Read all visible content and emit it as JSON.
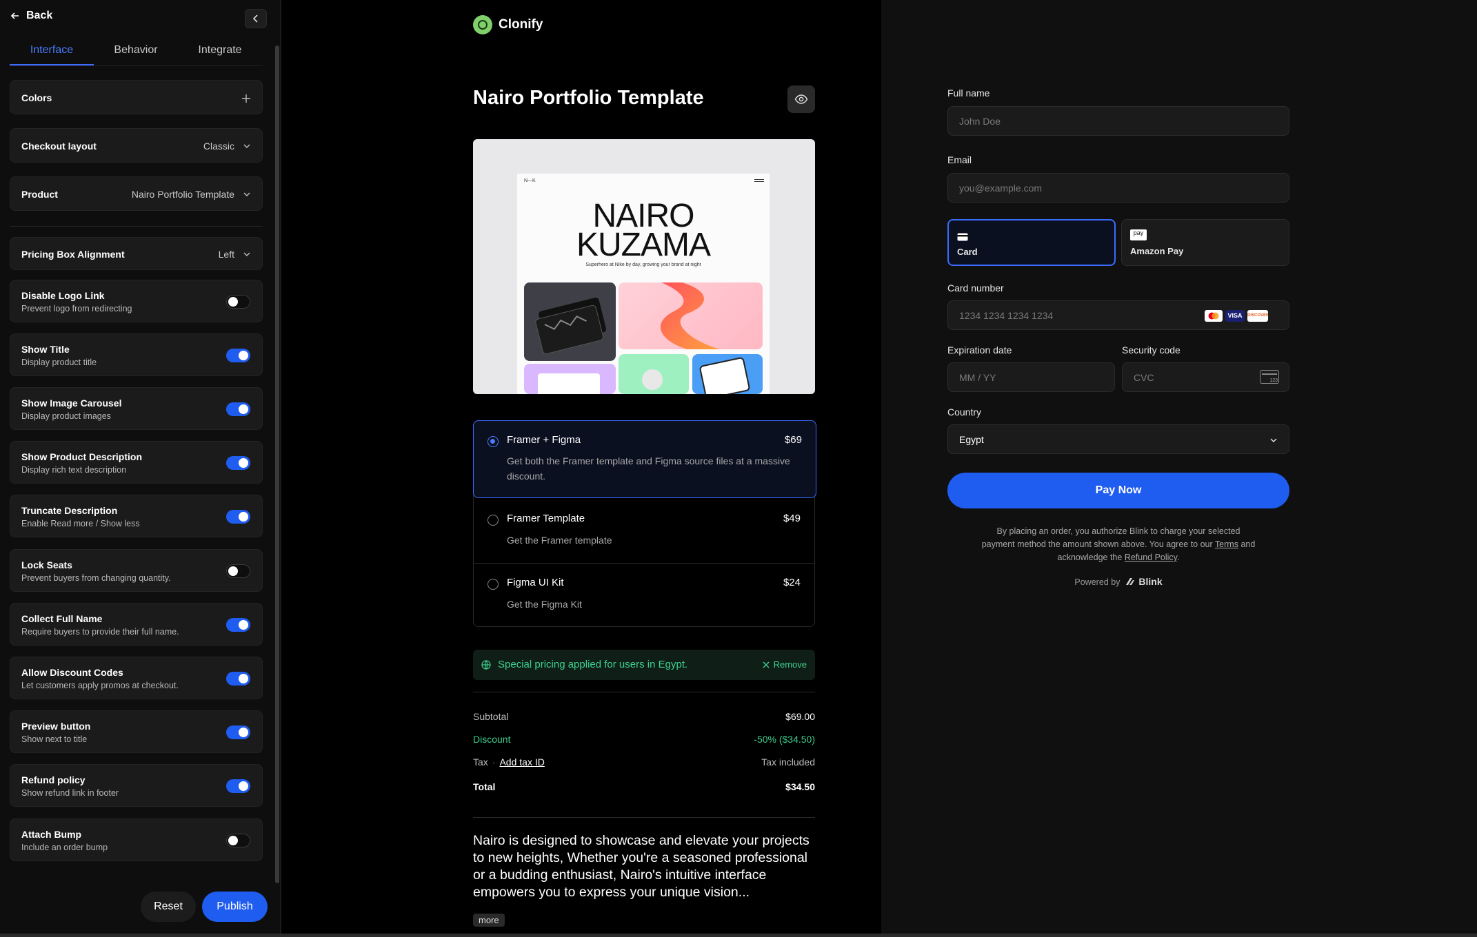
{
  "sidebar": {
    "back_label": "Back",
    "tabs": [
      "Interface",
      "Behavior",
      "Integrate"
    ],
    "colors_label": "Colors",
    "checkout_layout": {
      "label": "Checkout layout",
      "value": "Classic"
    },
    "product": {
      "label": "Product",
      "value": "Nairo Portfolio Template"
    },
    "pricing_alignment": {
      "label": "Pricing Box Alignment",
      "value": "Left"
    },
    "toggles": [
      {
        "title": "Disable Logo Link",
        "desc": "Prevent logo from redirecting",
        "on": false
      },
      {
        "title": "Show Title",
        "desc": "Display product title",
        "on": true
      },
      {
        "title": "Show Image Carousel",
        "desc": "Display product images",
        "on": true
      },
      {
        "title": "Show Product Description",
        "desc": "Display rich text description",
        "on": true
      },
      {
        "title": "Truncate Description",
        "desc": "Enable Read more / Show less",
        "on": true
      },
      {
        "title": "Lock Seats",
        "desc": "Prevent buyers from changing quantity.",
        "on": false
      },
      {
        "title": "Collect Full Name",
        "desc": "Require buyers to provide their full name.",
        "on": true
      },
      {
        "title": "Allow Discount Codes",
        "desc": "Let customers apply promos at checkout.",
        "on": true
      },
      {
        "title": "Preview button",
        "desc": "Show next to title",
        "on": true
      },
      {
        "title": "Refund policy",
        "desc": "Show refund link in footer",
        "on": true
      },
      {
        "title": "Attach Bump",
        "desc": "Include an order bump",
        "on": false
      }
    ],
    "reset_label": "Reset",
    "publish_label": "Publish"
  },
  "checkout": {
    "brand": "Clonify",
    "product_title": "Nairo Portfolio Template",
    "preview_image": {
      "corner_text": "N—K",
      "hero_line1": "NAIRO",
      "hero_line2": "KUZAMA",
      "tagline": "Superhero at Nike by day, growing your brand at night"
    },
    "options": [
      {
        "name": "Framer + Figma",
        "price": "$69",
        "desc": "Get both the Framer template and Figma source files at a massive discount.",
        "selected": true
      },
      {
        "name": "Framer Template",
        "price": "$49",
        "desc": "Get the Framer template",
        "selected": false
      },
      {
        "name": "Figma UI Kit",
        "price": "$24",
        "desc": "Get the Figma Kit",
        "selected": false
      }
    ],
    "notice": {
      "text": "Special pricing applied for users in Egypt.",
      "remove_label": "Remove"
    },
    "summary": {
      "subtotal_label": "Subtotal",
      "subtotal_value": "$69.00",
      "discount_label": "Discount",
      "discount_value": "-50% ($34.50)",
      "tax_label": "Tax",
      "tax_link": "Add tax ID",
      "tax_value": "Tax included",
      "total_label": "Total",
      "total_value": "$34.50"
    },
    "description": "Nairo is designed to showcase and elevate your projects to new heights, Whether you're a seasoned professional or a budding enthusiast, Nairo's intuitive interface empowers you to express your unique vision...",
    "more_label": "more"
  },
  "payment": {
    "full_name": {
      "label": "Full name",
      "placeholder": "John Doe"
    },
    "email": {
      "label": "Email",
      "placeholder": "you@example.com"
    },
    "methods": [
      {
        "label": "Card",
        "selected": true
      },
      {
        "label": "Amazon Pay",
        "selected": false
      }
    ],
    "amazon_badge": "pay",
    "card_number": {
      "label": "Card number",
      "placeholder": "1234 1234 1234 1234"
    },
    "card_brands": [
      "VISA",
      "DISCOVER"
    ],
    "expiration": {
      "label": "Expiration date",
      "placeholder": "MM / YY"
    },
    "security": {
      "label": "Security code",
      "placeholder": "CVC",
      "hint": "123"
    },
    "country": {
      "label": "Country",
      "value": "Egypt"
    },
    "pay_label": "Pay Now",
    "legal": {
      "text1": "By placing an order, you authorize Blink to charge your selected payment method the amount shown above. You agree to our",
      "terms": "Terms",
      "text2": "and acknowledge the",
      "refund": "Refund Policy",
      "text3": "."
    },
    "powered_by": "Powered by",
    "powered_brand": "Blink"
  },
  "colors": {
    "accent": "#1f5cf0",
    "success": "#3ecf8e",
    "panel": "#1b1b1b"
  }
}
